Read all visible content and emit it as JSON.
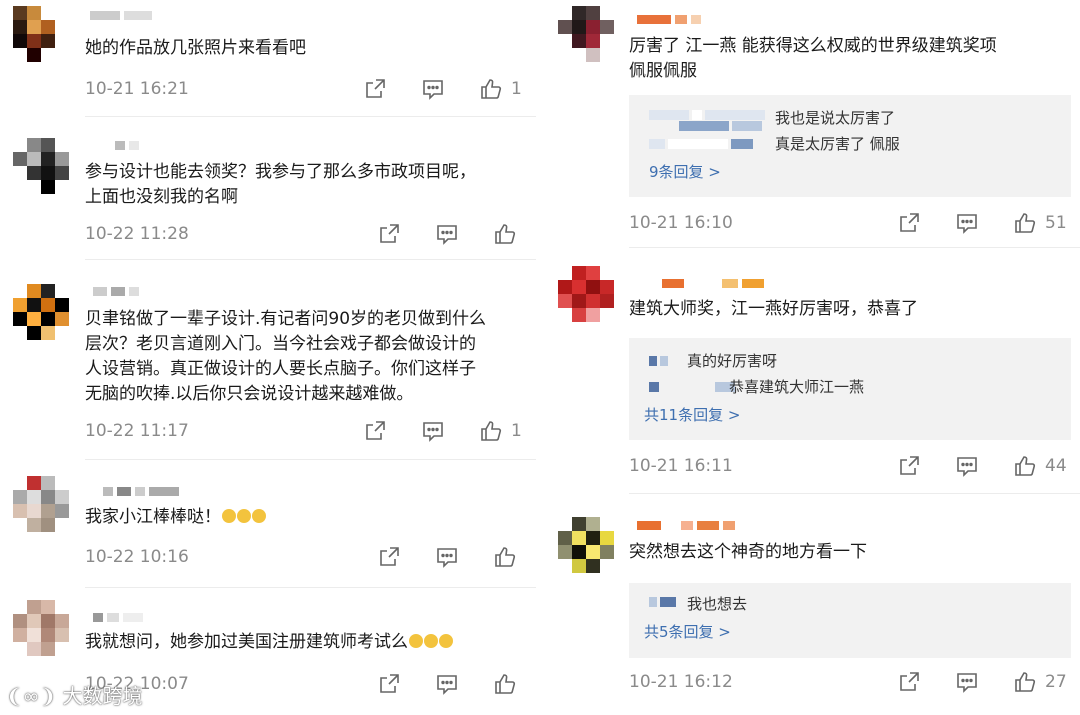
{
  "colors": {
    "text": "#1a1a1a",
    "meta": "#8a8a8a",
    "reply_link": "#3e6fb0",
    "reply_bg": "#f2f2f2"
  },
  "left": [
    {
      "text_lines": [
        "她的作品放几张照片来看看吧"
      ],
      "time": "10-21 16:21",
      "likes": "1"
    },
    {
      "text_lines": [
        "参与设计也能去领奖？我参与了那么多市政项目呢，",
        "上面也没刻我的名啊"
      ],
      "time": "10-22 11:28",
      "likes": ""
    },
    {
      "text_lines": [
        "贝聿铭做了一辈子设计.有记者问90岁的老贝做到什么",
        "层次？老贝言道刚入门。当今社会戏子都会做设计的",
        "人设营销。真正做设计的人要长点脑子。你们这样子",
        "无脑的吹捧.以后你只会说设计越来越难做。"
      ],
      "time": "10-22 11:17",
      "likes": "1"
    },
    {
      "text_lines": [
        "我家小江棒棒哒！"
      ],
      "time": "10-22 10:16",
      "likes": ""
    },
    {
      "text_lines": [
        "我就想问，她参加过美国注册建筑师考试么"
      ],
      "time": "10-22 10:07",
      "likes": ""
    }
  ],
  "right": [
    {
      "text_lines": [
        "厉害了  江一燕   能获得这么权威的世界级建筑奖项",
        "佩服佩服"
      ],
      "replies": [
        "我也是说太厉害了",
        "真是太厉害了 佩服"
      ],
      "reply_link": "9条回复 >",
      "time": "10-21 16:10",
      "likes": "51"
    },
    {
      "text_lines": [
        "建筑大师奖，江一燕好厉害呀，恭喜了"
      ],
      "replies": [
        "真的好厉害呀",
        "恭喜建筑大师江一燕"
      ],
      "reply_link": "共11条回复 >",
      "time": "10-21 16:11",
      "likes": "44"
    },
    {
      "text_lines": [
        "突然想去这个神奇的地方看一下"
      ],
      "replies": [
        "我也想去"
      ],
      "reply_link": "共5条回复 >",
      "time": "10-21 16:12",
      "likes": "27"
    }
  ],
  "icons": {
    "share": "share-icon",
    "comment": "comment-icon",
    "like": "thumbs-up-icon"
  },
  "watermark": "大数跨境"
}
